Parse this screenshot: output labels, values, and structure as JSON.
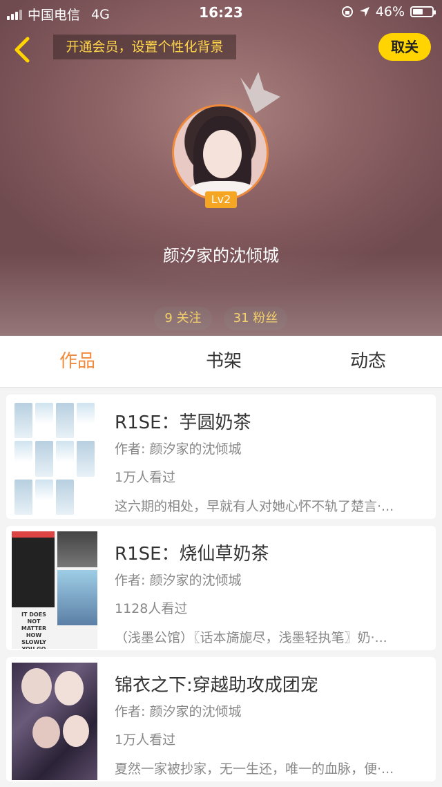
{
  "status_bar": {
    "carrier": "中国电信",
    "network": "4G",
    "time": "16:23",
    "battery": "46%"
  },
  "header": {
    "promo": "开通会员，设置个性化背景",
    "follow_button": "取关",
    "level": "Lv2",
    "username": "颜汐家的沈倾城",
    "following": "9 关注",
    "followers": "31 粉丝"
  },
  "tabs": [
    {
      "label": "作品",
      "active": true
    },
    {
      "label": "书架",
      "active": false
    },
    {
      "label": "动态",
      "active": false
    }
  ],
  "works": [
    {
      "title": "R1SE：芋圆奶茶",
      "author": "作者: 颜汐家的沈倾城",
      "views": "1万人看过",
      "description": "这六期的相处，早就有人对她心怀不轨了楚言·..."
    },
    {
      "title": "R1SE：烧仙草奶茶",
      "author": "作者: 颜汐家的沈倾城",
      "views": "1128人看过",
      "description": "（浅墨公馆）〖话本旖旎尽，浅墨轻执笔〗奶·...",
      "cover_text": "IT DOES NOT MATTER HOW SLOWLY YOU GO"
    },
    {
      "title": "锦衣之下:穿越助攻成团宠",
      "author": "作者: 颜汐家的沈倾城",
      "views": "1万人看过",
      "description": "夏然一家被抄家，无一生还，唯一的血脉，便·..."
    }
  ],
  "colors": {
    "accent": "#f08a3c",
    "follow_bg": "#ffd400",
    "promo_text": "#ffd54a"
  }
}
